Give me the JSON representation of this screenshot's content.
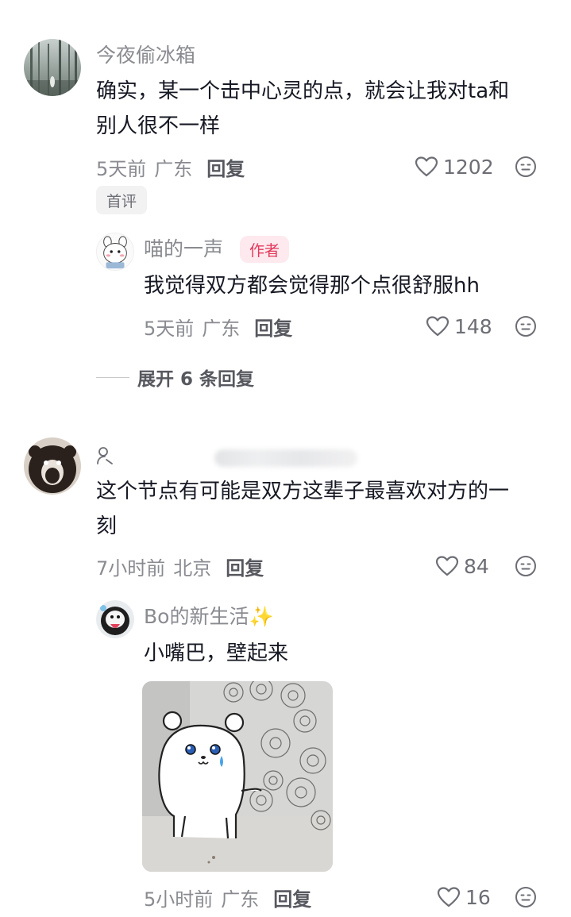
{
  "comments": [
    {
      "username": "今夜偷冰箱",
      "text_lines": [
        "确实，某一个击中心灵的点，就会让我对ta和",
        "别人很不一样"
      ],
      "time": "5天前",
      "location": "广东",
      "reply_label": "回复",
      "likes": "1202",
      "tag": "首评",
      "replies": [
        {
          "username": "喵的一声",
          "badge": "作者",
          "text": "我觉得双方都会觉得那个点很舒服hh",
          "time": "5天前",
          "location": "广东",
          "reply_label": "回复",
          "likes": "148"
        }
      ],
      "expand_label": "展开 6 条回复"
    },
    {
      "username": "",
      "text_lines": [
        "这个节点有可能是双方这辈子最喜欢对方的一",
        "刻"
      ],
      "time": "7小时前",
      "location": "北京",
      "reply_label": "回复",
      "likes": "84",
      "replies": [
        {
          "username": "Bo的新生活✨",
          "text": "小嘴巴，壁起来",
          "time": "5小时前",
          "location": "广东",
          "reply_label": "回复",
          "likes": "16"
        }
      ]
    }
  ],
  "icons": {
    "like": "heart-outline-icon",
    "emoji": "emoji-face-icon",
    "user": "user-outline-icon"
  },
  "colors": {
    "text_primary": "#161823",
    "text_secondary": "#8a8b91",
    "author_badge_bg": "#fde9ee",
    "author_badge_text": "#e3375b"
  }
}
